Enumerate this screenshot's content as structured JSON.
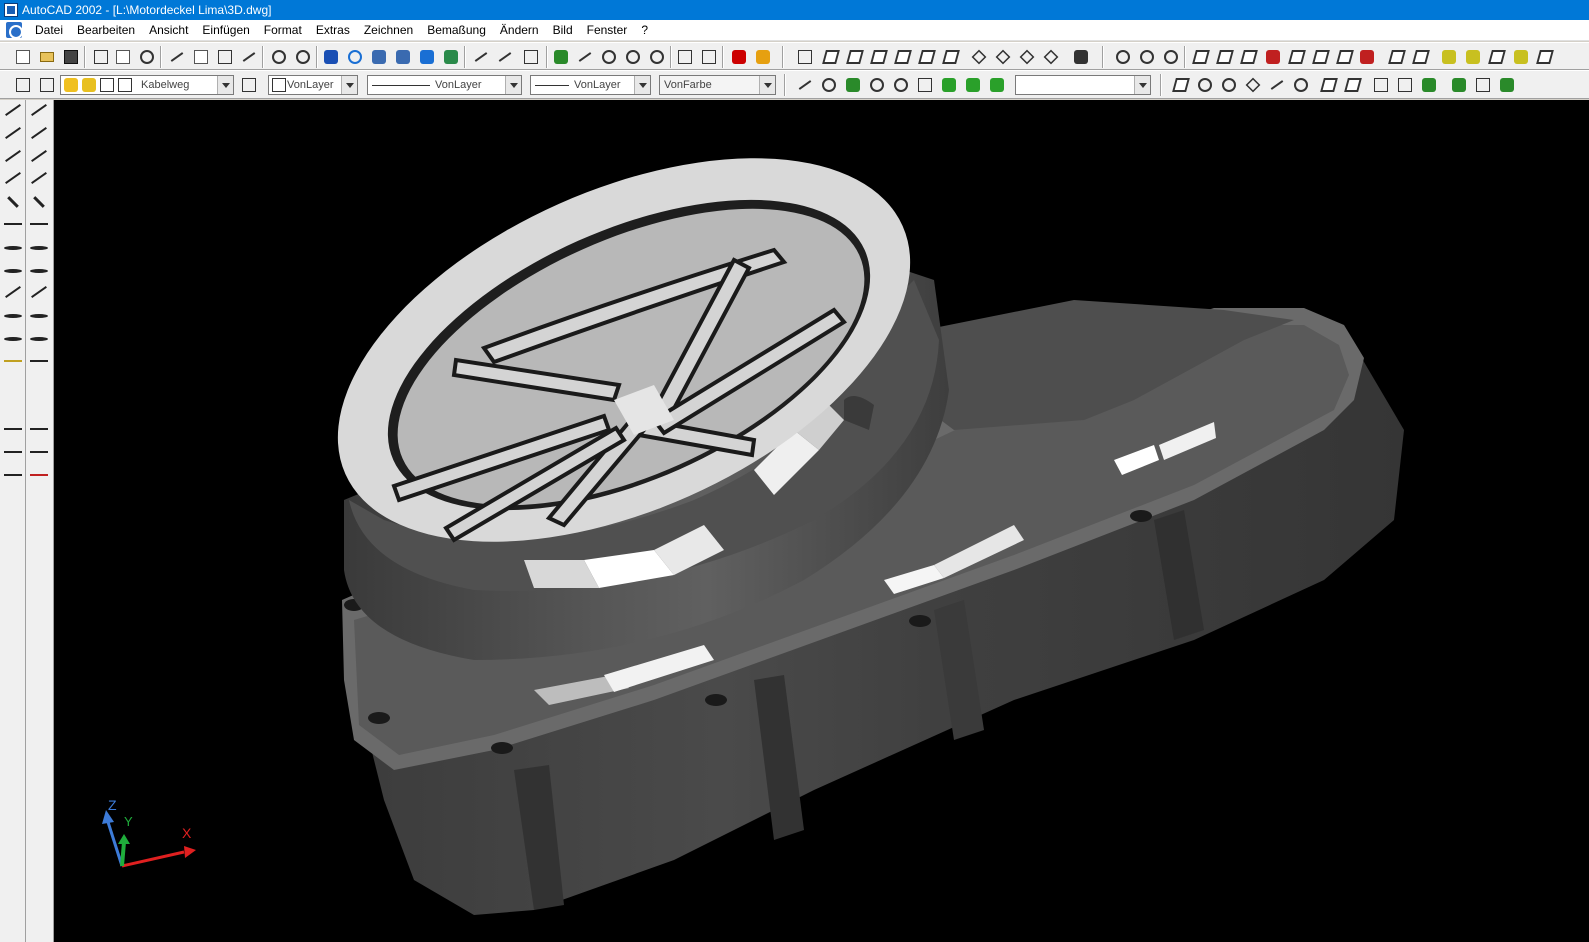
{
  "window": {
    "title": "AutoCAD 2002 - [L:\\Motordeckel Lima\\3D.dwg]"
  },
  "menu": [
    "Datei",
    "Bearbeiten",
    "Ansicht",
    "Einfügen",
    "Format",
    "Extras",
    "Zeichnen",
    "Bemaßung",
    "Ändern",
    "Bild",
    "Fenster",
    "?"
  ],
  "properties": {
    "layer": "Kabelweg",
    "color": "VonLayer",
    "linetype": "VonLayer",
    "lineweight": "VonLayer",
    "plotstyle": "VonFarbe",
    "view_combo": ""
  },
  "ucs": {
    "x_label": "X",
    "y_label": "Y",
    "z_label": "Z"
  },
  "colors": {
    "titlebar": "#0078d7",
    "canvas": "#000000",
    "toolbar": "#f0f0f0"
  },
  "icons": {
    "draw": [
      "line-icon",
      "xline-icon",
      "pline-icon",
      "mline-icon",
      "polygon-icon",
      "rectangle-icon",
      "arc-icon",
      "circle-icon",
      "spline-icon",
      "ellipse-icon",
      "ellipse-arc-icon",
      "insert-block-icon",
      "make-block-icon",
      "point-icon",
      "hatch-icon",
      "region-icon",
      "text-icon"
    ],
    "modify": [
      "erase-icon",
      "copy-icon",
      "mirror-icon",
      "offset-icon",
      "array-icon",
      "move-icon",
      "rotate-icon",
      "scale-icon",
      "stretch-icon",
      "lengthen-icon",
      "trim-icon",
      "extend-icon",
      "break-icon",
      "break-at-point-icon",
      "chamfer-icon",
      "fillet-icon",
      "explode-icon"
    ]
  }
}
